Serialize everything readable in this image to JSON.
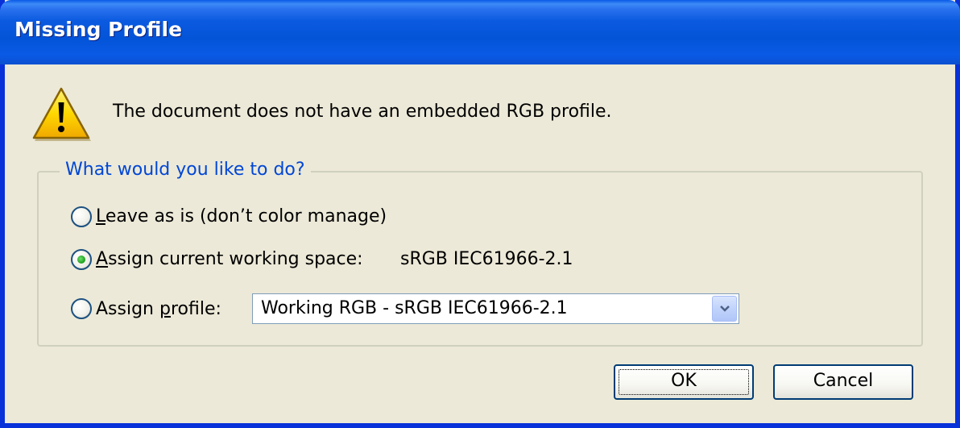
{
  "window": {
    "title": "Missing Profile"
  },
  "message": "The document does not have an embedded RGB profile.",
  "group": {
    "legend": "What would you like to do?",
    "options": [
      {
        "label_ul": "L",
        "label_rest": "eave as is (don’t color manage)",
        "selected": false
      },
      {
        "label_ul": "A",
        "label_rest": "ssign current working space:",
        "selected": true
      },
      {
        "label_pre": "Assign ",
        "label_ul": "p",
        "label_rest": "rofile:",
        "selected": false
      }
    ],
    "working_space_value": "sRGB IEC61966-2.1",
    "profile_select_value": "Working RGB - sRGB IEC61966-2.1"
  },
  "buttons": {
    "ok": "OK",
    "cancel": "Cancel"
  },
  "icons": {
    "warning": "warning-icon",
    "dropdown": "chevron-down-icon"
  },
  "colors": {
    "title_bar": "#0a5ae8",
    "legend_text": "#0046d5",
    "dialog_bg": "#ece9d8"
  }
}
